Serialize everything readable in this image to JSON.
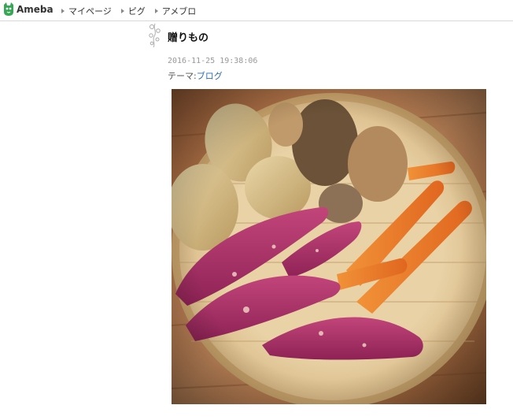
{
  "header": {
    "logo_text": "Ameba",
    "nav": [
      {
        "label": "マイページ"
      },
      {
        "label": "ピグ"
      },
      {
        "label": "アメブロ"
      }
    ]
  },
  "article": {
    "title": "贈りもの",
    "date": "2016-11-25 19:38:06",
    "theme_label": "テーマ:",
    "theme_value": "ブログ"
  },
  "colors": {
    "accent_green": "#34a853",
    "link_blue": "#2a6bb5"
  },
  "icons": [
    "ameba-logo-icon",
    "nav-arrow-icon",
    "flower-decoration-icon"
  ]
}
